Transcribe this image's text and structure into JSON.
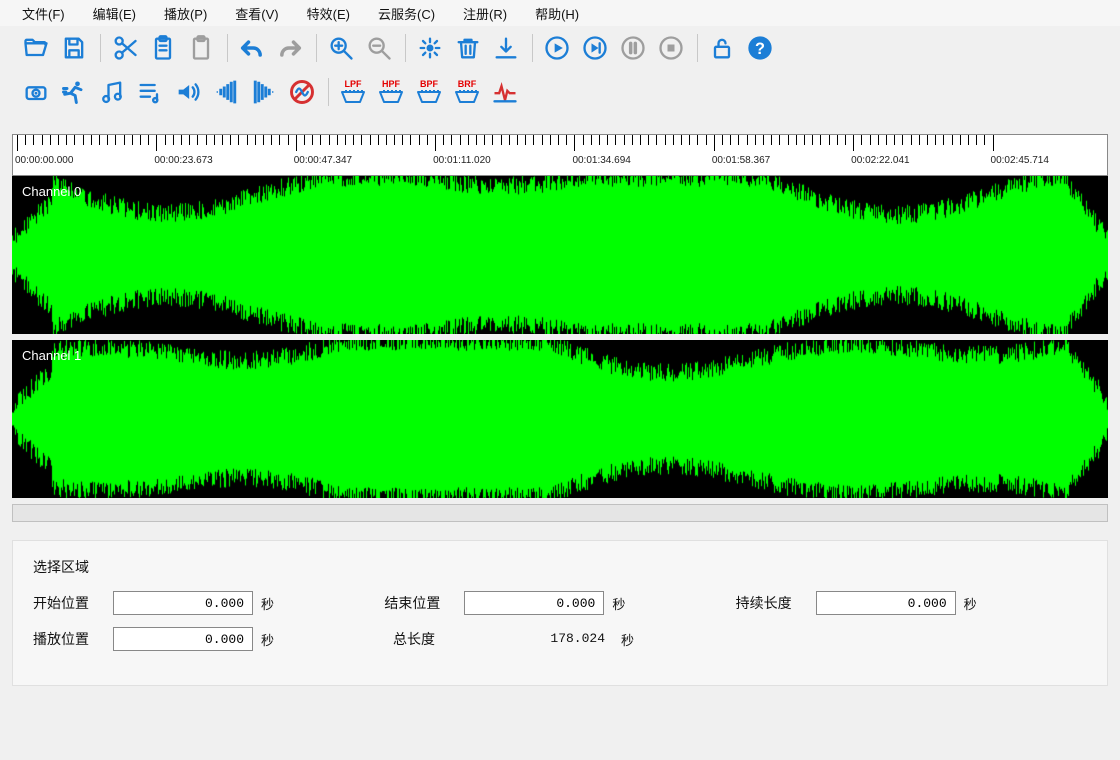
{
  "menu": {
    "file": "文件(F)",
    "edit": "编辑(E)",
    "play": "播放(P)",
    "view": "查看(V)",
    "fx": "特效(E)",
    "cloud": "云服务(C)",
    "register": "注册(R)",
    "help": "帮助(H)"
  },
  "toolbar1": {
    "open": "open",
    "save": "save",
    "cut": "cut",
    "copy": "copy",
    "paste": "paste",
    "undo": "undo",
    "redo": "redo",
    "zoom_in": "zoom-in",
    "zoom_out": "zoom-out",
    "effects": "effects",
    "delete": "delete",
    "export": "export",
    "play": "play",
    "play_loop": "play-loop",
    "pause": "pause",
    "stop": "stop",
    "unlock": "unlock",
    "help": "help"
  },
  "toolbar2": {
    "record": "record",
    "timestretch": "time-stretch",
    "music": "music-notes",
    "playlist": "playlist",
    "volume": "volume",
    "fade_in": "fade-in",
    "fade_out": "fade-out",
    "no_fx": "no-fx",
    "filters": [
      {
        "label": "LPF",
        "name": "lpf-filter"
      },
      {
        "label": "HPF",
        "name": "hpf-filter"
      },
      {
        "label": "BPF",
        "name": "bpf-filter"
      },
      {
        "label": "BRF",
        "name": "brf-filter"
      }
    ],
    "normalize": "normalize"
  },
  "ruler": {
    "labels": [
      "00:00:00.000",
      "00:00:23.673",
      "00:00:47.347",
      "00:01:11.020",
      "00:01:34.694",
      "00:01:58.367",
      "00:02:22.041",
      "00:02:45.714"
    ]
  },
  "channels": [
    {
      "label": "Channel 0"
    },
    {
      "label": "Channel 1"
    }
  ],
  "selection": {
    "title": "选择区域",
    "start_label": "开始位置",
    "end_label": "结束位置",
    "duration_label": "持续长度",
    "play_label": "播放位置",
    "total_label": "总长度",
    "unit": "秒",
    "start_value": "0.000",
    "end_value": "0.000",
    "duration_value": "0.000",
    "play_value": "0.000",
    "total_value": "178.024"
  },
  "colors": {
    "accent": "#1c7ed6",
    "waveform": "#00ff00",
    "filter_label": "#e40000"
  }
}
